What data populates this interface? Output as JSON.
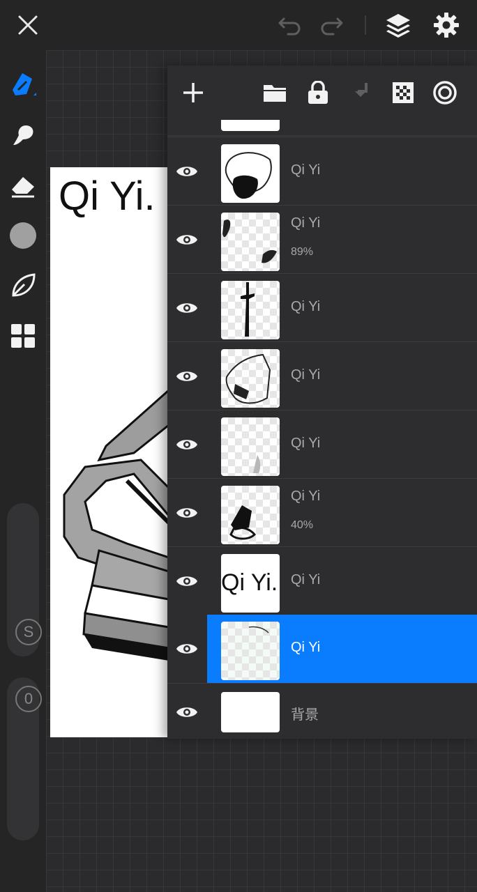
{
  "topbar": {
    "close_icon": "close-icon",
    "undo_icon": "undo-icon",
    "redo_icon": "redo-icon",
    "layers_icon": "layers-icon",
    "settings_icon": "gear-icon"
  },
  "toolbar": {
    "tools": [
      "pen-tool-icon",
      "smudge-icon",
      "eraser-icon",
      "color-circle-icon",
      "leaf-icon",
      "grid-icon"
    ],
    "size_slider_label": "S",
    "opacity_slider_label": "0"
  },
  "canvas": {
    "text": "Qi Yi."
  },
  "layers_panel": {
    "header_icons": [
      "add-layer-icon",
      "folder-icon",
      "lock-icon",
      "merge-down-icon",
      "checkerboard-icon",
      "target-icon"
    ],
    "layers": [
      {
        "name": "Qi Yi",
        "opacity": ""
      },
      {
        "name": "Qi Yi",
        "opacity": "89%"
      },
      {
        "name": "Qi Yi",
        "opacity": ""
      },
      {
        "name": "Qi Yi",
        "opacity": ""
      },
      {
        "name": "Qi Yi",
        "opacity": ""
      },
      {
        "name": "Qi Yi",
        "opacity": "40%"
      },
      {
        "name": "Qi Yi",
        "opacity": "",
        "thumb_text": "Qi Yi."
      },
      {
        "name": "Qi Yi",
        "opacity": "",
        "selected": true
      },
      {
        "name": "背景",
        "opacity": ""
      }
    ]
  },
  "colors": {
    "accent": "#0a7dff",
    "background": "#252526",
    "panel": "#2d2d2f"
  }
}
